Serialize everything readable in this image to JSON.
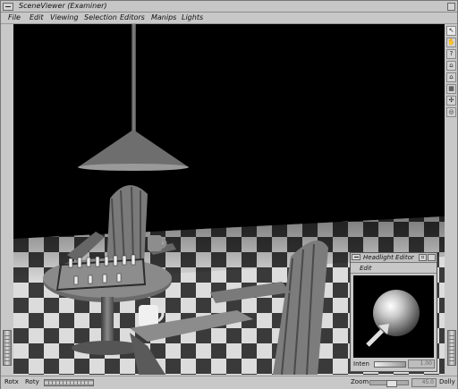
{
  "window": {
    "title": "SceneViewer (Examiner)"
  },
  "menubar": {
    "items": [
      "File",
      "Edit",
      "Viewing",
      "Selection",
      "Editors",
      "Manips",
      "Lights"
    ]
  },
  "toolbar": {
    "icons": [
      "pick-arrow-icon",
      "view-hand-icon",
      "help-icon",
      "home-icon",
      "set-home-icon",
      "view-all-icon",
      "seek-icon",
      "camera-type-icon"
    ],
    "glyphs": [
      "↖",
      "✋",
      "?",
      "⌂",
      "⌂",
      "▦",
      "✣",
      "◎"
    ]
  },
  "bottombar": {
    "rotx_label": "Rotx",
    "roty_label": "Roty",
    "zoom_label": "Zoom",
    "zoom_value": "45.0",
    "dolly_label": "Dolly"
  },
  "headlight_editor": {
    "title": "Headlight Editor",
    "menu_edit": "Edit",
    "min_glyph": "▫",
    "intensity_label": "Inten",
    "intensity_value": "1.00"
  }
}
